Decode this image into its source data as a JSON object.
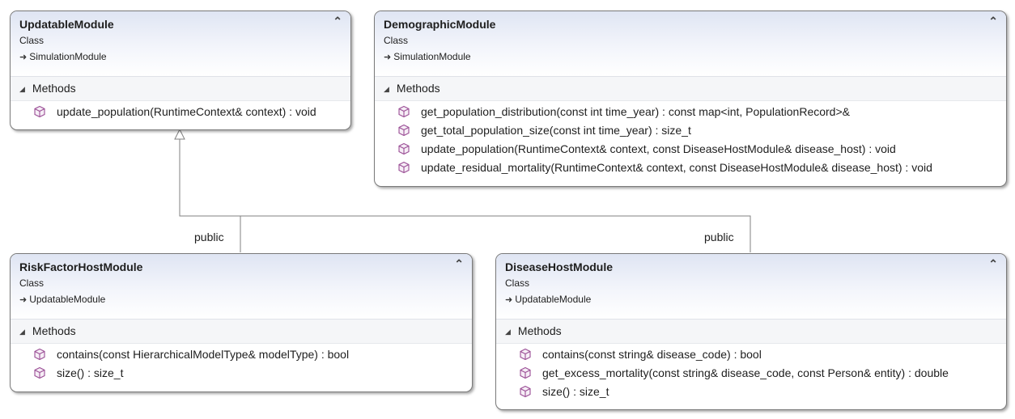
{
  "classes": {
    "updatable": {
      "name": "UpdatableModule",
      "kind": "Class",
      "parent": "SimulationModule",
      "section": "Methods",
      "methods": [
        "update_population(RuntimeContext& context) : void"
      ]
    },
    "demographic": {
      "name": "DemographicModule",
      "kind": "Class",
      "parent": "SimulationModule",
      "section": "Methods",
      "methods": [
        "get_population_distribution(const int time_year) : const map<int, PopulationRecord>&",
        "get_total_population_size(const int time_year) : size_t",
        "update_population(RuntimeContext& context, const DiseaseHostModule& disease_host) : void",
        "update_residual_mortality(RuntimeContext& context, const DiseaseHostModule& disease_host) : void"
      ]
    },
    "riskfactor": {
      "name": "RiskFactorHostModule",
      "kind": "Class",
      "parent": "UpdatableModule",
      "section": "Methods",
      "methods": [
        "contains(const HierarchicalModelType& modelType) : bool",
        "size() : size_t"
      ]
    },
    "disease": {
      "name": "DiseaseHostModule",
      "kind": "Class",
      "parent": "UpdatableModule",
      "section": "Methods",
      "methods": [
        "contains(const string& disease_code) : bool",
        "get_excess_mortality(const string& disease_code, const Person& entity) : double",
        "size() : size_t"
      ]
    }
  },
  "relations": {
    "left_label": "public",
    "right_label": "public"
  },
  "icons": {
    "collapse": "double-chevron-up-icon",
    "inherits": "inheritance-arrow-icon",
    "expander": "triangle-down-icon",
    "method": "method-cube-icon"
  },
  "colors": {
    "header_gradient_top": "#dfe5f3",
    "method_icon": "#9b4f96",
    "connector": "#808080"
  }
}
